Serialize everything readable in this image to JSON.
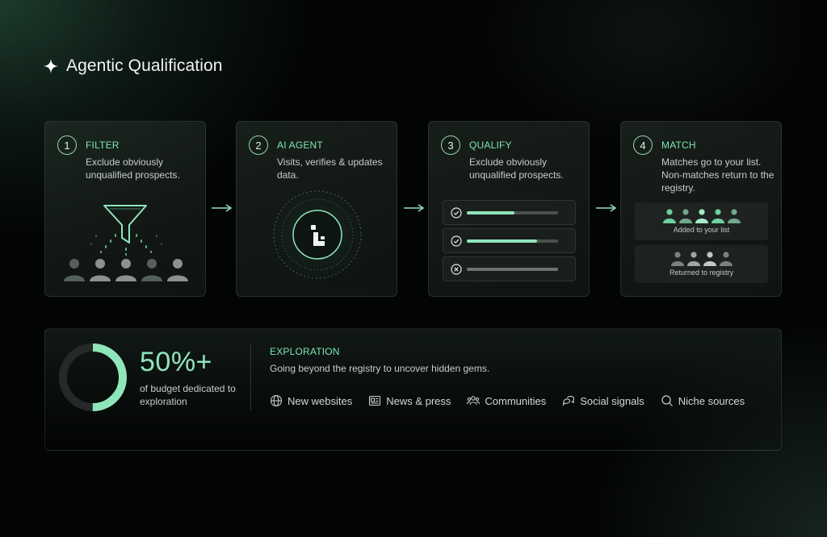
{
  "header": {
    "title": "Agentic Qualification",
    "icon": "sparkle-icon"
  },
  "steps": [
    {
      "num": "1",
      "label": "FILTER",
      "desc": "Exclude obviously unqualified prospects.",
      "illustration": "funnel-icon"
    },
    {
      "num": "2",
      "label": "AI AGENT",
      "desc": "Visits, verifies & updates data.",
      "illustration": "agent-logo-icon"
    },
    {
      "num": "3",
      "label": "QUALIFY",
      "desc": "Exclude obviously unqualified prospects.",
      "rows": [
        {
          "status": "check-icon",
          "progress": 0.52
        },
        {
          "status": "check-icon",
          "progress": 0.77
        },
        {
          "status": "x-icon",
          "progress": 1.0
        }
      ]
    },
    {
      "num": "4",
      "label": "MATCH",
      "desc": "Matches go to your list. Non-matches return to the registry.",
      "added_label": "Added to your list",
      "returned_label": "Returned to registry"
    }
  ],
  "exploration": {
    "stat_value": "50%+",
    "stat_fraction": 0.5,
    "stat_desc": "of budget dedicated to exploration",
    "label": "EXPLORATION",
    "desc": "Going beyond the registry to uncover hidden gems.",
    "sources": [
      {
        "label": "New websites",
        "icon": "globe-icon"
      },
      {
        "label": "News & press",
        "icon": "newspaper-icon"
      },
      {
        "label": "Communities",
        "icon": "people-icon"
      },
      {
        "label": "Social signals",
        "icon": "chat-bubbles-icon"
      },
      {
        "label": "Niche sources",
        "icon": "search-icon"
      }
    ]
  },
  "colors": {
    "accent": "#7de8b2",
    "accent_fill": "#8fe6bb",
    "background": "#030504"
  }
}
